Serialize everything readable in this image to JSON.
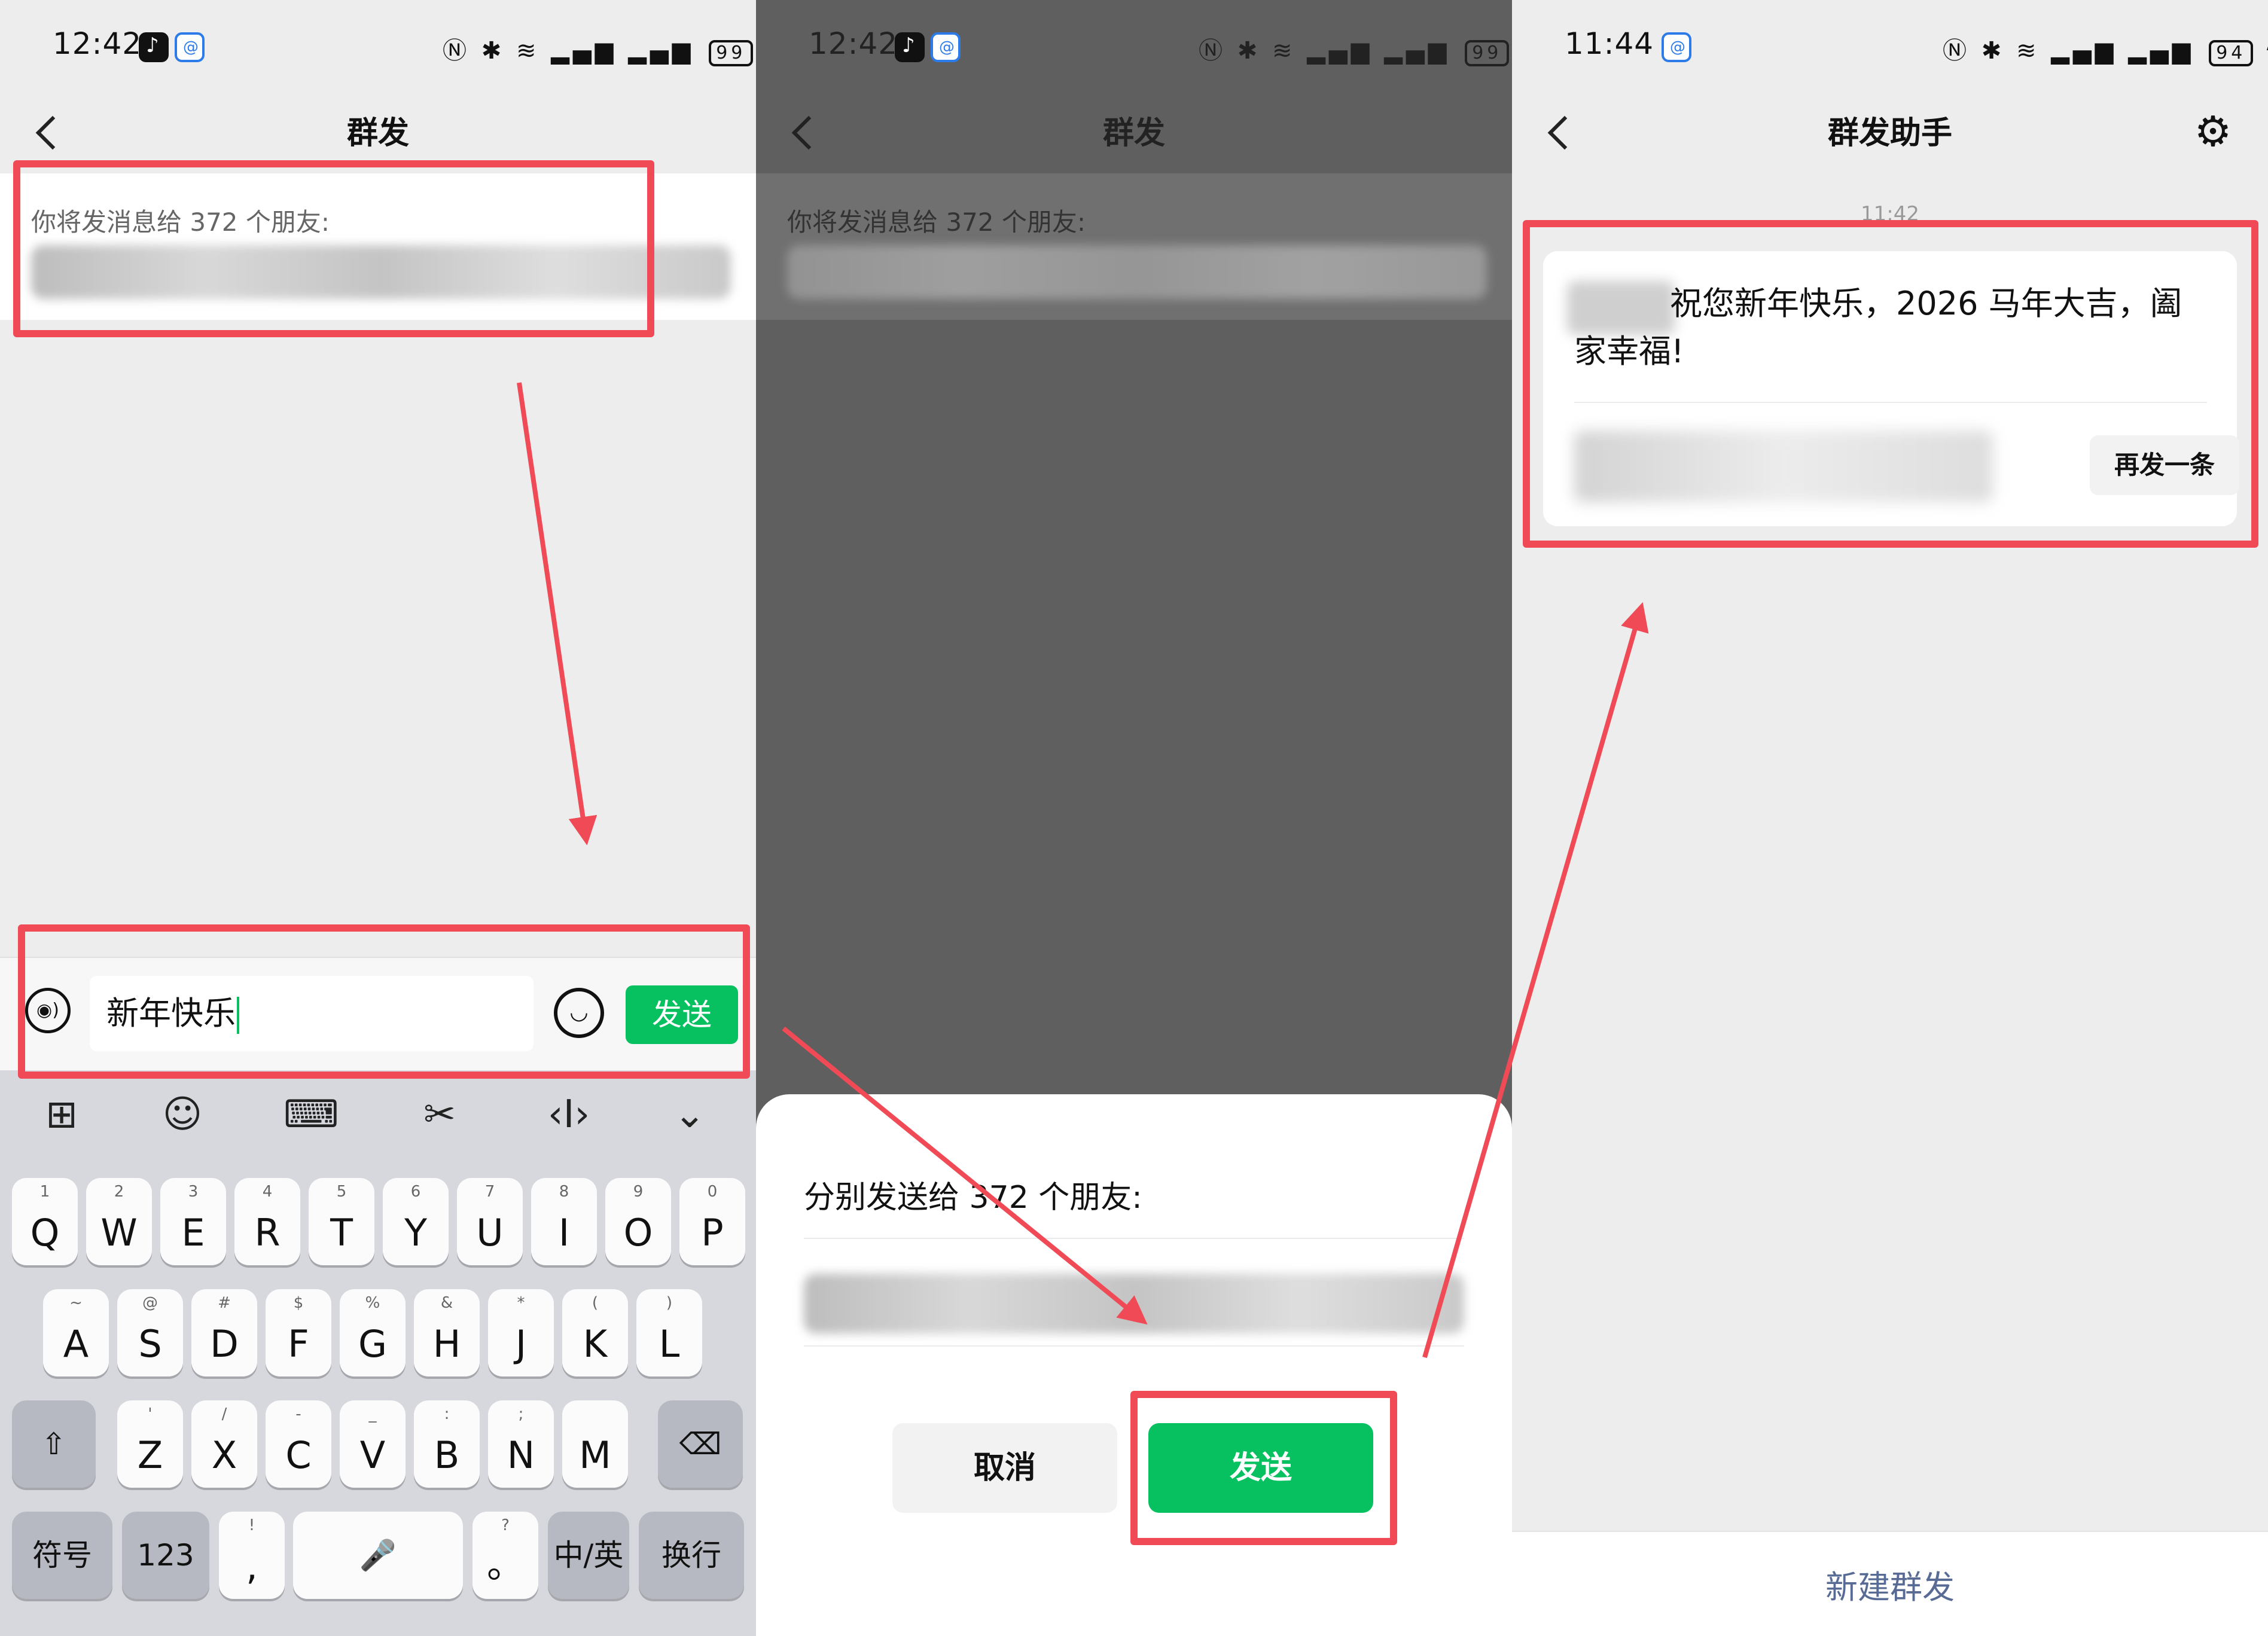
{
  "colors": {
    "accent_green": "#07c160",
    "highlight_red": "#ef4a55",
    "link_blue": "#576b95"
  },
  "panel1": {
    "status": {
      "time": "12:42",
      "battery": "99"
    },
    "title": "群发",
    "recipient_text": "你将发消息给 372 个朋友:",
    "input_value": "新年快乐",
    "send_label": "发送",
    "keyboard": {
      "row1": [
        [
          "1",
          "Q"
        ],
        [
          "2",
          "W"
        ],
        [
          "3",
          "E"
        ],
        [
          "4",
          "R"
        ],
        [
          "5",
          "T"
        ],
        [
          "6",
          "Y"
        ],
        [
          "7",
          "U"
        ],
        [
          "8",
          "I"
        ],
        [
          "9",
          "O"
        ],
        [
          "0",
          "P"
        ]
      ],
      "row2": [
        [
          "~",
          "A"
        ],
        [
          "@",
          "S"
        ],
        [
          "#",
          "D"
        ],
        [
          "$",
          "F"
        ],
        [
          "%",
          "G"
        ],
        [
          "&",
          "H"
        ],
        [
          "*",
          "J"
        ],
        [
          "(",
          "K"
        ],
        [
          ")",
          "L"
        ]
      ],
      "row3": [
        [
          "'",
          "Z"
        ],
        [
          "/",
          "X"
        ],
        [
          "-",
          "C"
        ],
        [
          "_",
          "V"
        ],
        [
          ":",
          "B"
        ],
        [
          ";",
          "N"
        ],
        [
          "",
          "M"
        ]
      ],
      "symbols_label": "符号",
      "numbers_label": "123",
      "comma_hint": "!",
      "comma_main": ",",
      "period_hint": "?",
      "period_main": "。",
      "lang_label": "中",
      "lang_sub": "/英",
      "enter_label": "换行"
    }
  },
  "panel2": {
    "status": {
      "time": "12:42",
      "battery": "99"
    },
    "title": "群发",
    "recipient_text": "你将发消息给 372 个朋友:",
    "sheet_title": "分别发送给 372 个朋友:",
    "cancel_label": "取消",
    "confirm_label": "发送"
  },
  "panel3": {
    "status": {
      "time": "11:44",
      "battery": "94"
    },
    "title": "群发助手",
    "message_time": "11:42",
    "message_text": "祝您新年快乐，2026 马年大吉，阖家幸福!",
    "resend_label": "再发一条",
    "new_label": "新建群发"
  }
}
